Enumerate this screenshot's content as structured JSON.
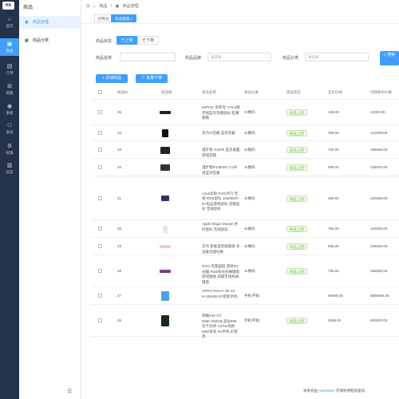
{
  "rail": {
    "logo": "HA",
    "items": [
      {
        "label": "首页",
        "icon": "home-icon",
        "glyph": "⌂"
      },
      {
        "label": "商品",
        "icon": "bag-icon",
        "glyph": "▣"
      },
      {
        "label": "订单",
        "icon": "order-icon",
        "glyph": "▤"
      },
      {
        "label": "商家",
        "icon": "shop-icon",
        "glyph": "⊞"
      },
      {
        "label": "系统",
        "icon": "user-icon",
        "glyph": "◉"
      },
      {
        "label": "会员",
        "icon": "member-icon",
        "glyph": "⚇"
      },
      {
        "label": "权限",
        "icon": "gear-icon",
        "glyph": "⚙"
      },
      {
        "label": "日志",
        "icon": "log-icon",
        "glyph": "▥"
      }
    ]
  },
  "side2": {
    "title": "商品",
    "items": [
      {
        "label": "商品管理",
        "icon": "goods-icon"
      },
      {
        "label": "商品分类",
        "icon": "category-icon"
      }
    ],
    "collapse_glyph": "☰"
  },
  "breadcrumb": [
    "商品",
    "商品管理"
  ],
  "tabs": [
    "控制台",
    "商品管理"
  ],
  "tab_close": "×",
  "filters": {
    "status_label": "商品状态",
    "status_on": "已上架",
    "status_off": "已下架",
    "name_label": "商品名称",
    "brand_label": "商品品牌",
    "brand_placeholder": "请选择",
    "category_label": "商品分类",
    "category_placeholder": "请选择",
    "search_label": "搜索"
  },
  "actions": {
    "add": "添加商品",
    "batch_off": "批量下架"
  },
  "table": {
    "headers": [
      "商品ID",
      "商品图",
      "商品名称",
      "商品分类",
      "商品状态",
      "显示价格",
      "付款购买价格"
    ],
    "rows": [
      {
        "id": "35",
        "name": "INPHIC 英菲克 V75 5键 无线蓝牙双模鼠标 轻薄便携",
        "category": "3c数码",
        "status": "商品上架",
        "price": "199.00",
        "pay": "41000.00"
      },
      {
        "id": "34",
        "name": "华为AI音箱 蓝牙音箱",
        "category": "3c数码",
        "status": "商品上架",
        "price": "399.00",
        "pay": "123000.00"
      },
      {
        "id": "33",
        "name": "漫步者 G2000 蓝牙桌面游戏音箱",
        "category": "3c数码",
        "status": "商品上架",
        "price": "799.00",
        "pay": "286590.00"
      },
      {
        "id": "32",
        "name": "漫步者R1080BT 2.0声道蓝牙音箱",
        "category": "3c数码",
        "status": "商品上架",
        "price": "999.00",
        "pay": "328000.00"
      },
      {
        "id": "31",
        "name": "Asus华硕 ROG月刃 无线 RGB鼠标 16000DPI 6V电竞游戏鼠标 双模鼠标 无线鼠标",
        "category": "3c数码",
        "status": "商品上架",
        "price": "359.00",
        "pay": "122590.00"
      },
      {
        "id": "30",
        "name": "Apple Magic Mouse 妙控鼠标 无线鼠标",
        "category": "3c数码",
        "status": "商品上架",
        "price": "799.00",
        "pay": "123000.00"
      },
      {
        "id": "29",
        "name": "华为 智能型智能键盘 多设备无缝切换",
        "category": "3c数码",
        "status": "商品上架",
        "price": "599.00",
        "pay": "205000.00"
      },
      {
        "id": "28",
        "name": "ROG 玩家国度 游侠RX 光轴 RGB背光机械键盘 游戏键盘 双模无线机械键盘",
        "category": "3c数码",
        "status": "商品上架",
        "price": "799.00",
        "pay": "286590.00"
      },
      {
        "id": "27",
        "name": "OPPO Reno7 SE 5G 8+256GB 5G智能手机",
        "category": "手机/平板",
        "status": "",
        "price": "99999.00",
        "pay": "8899998.00"
      },
      {
        "id": "26",
        "name": "荣耀X40 GT 8GB+256GB 骁龙888 双卡双待 120Hz高刷 66W快充 5G手机 幻夜黑",
        "category": "手机/平板",
        "status": "商品上架",
        "price": "2999.00",
        "pay": "820000.00"
      }
    ]
  },
  "footer": {
    "prefix": "本系统由",
    "link": "HashMark",
    "suffix": "开源免费框架驱动"
  }
}
